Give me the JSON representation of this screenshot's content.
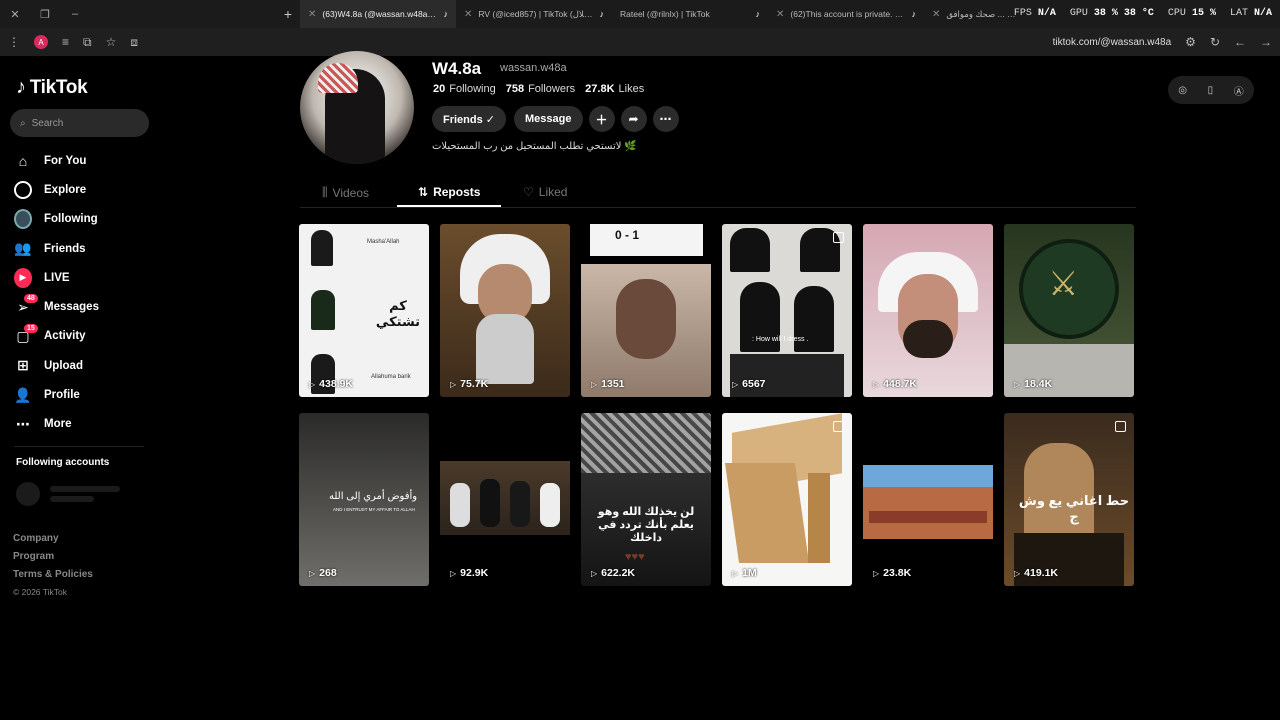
{
  "browser": {
    "tabs": [
      {
        "title": "(63)W4.8a (@wassan.w48a) | Ti",
        "active": true
      },
      {
        "title": "RV (@iced857) | TikTok (طلال)",
        "active": false
      },
      {
        "title": "Rateel (@rilnlx) | TikTok",
        "active": false
      },
      {
        "title": "(62)This account is private. Foll",
        "active": false
      },
      {
        "title": "ردة ... صحك وموافق",
        "active": false
      }
    ],
    "url": "tiktok.com/@wassan.w48a",
    "profile_initial": "A"
  },
  "hud": {
    "fps_label": "FPS",
    "fps_value": "N/A",
    "gpu_label": "GPU",
    "gpu_value": "38 % 38 °C",
    "cpu_label": "CPU",
    "cpu_value": "15 %",
    "lat_label": "LAT",
    "lat_value": "N/A"
  },
  "sidebar": {
    "logo_text": "TikTok",
    "search_placeholder": "Search",
    "nav": [
      {
        "label": "For You",
        "icon": "home-icon"
      },
      {
        "label": "Explore",
        "icon": "compass-icon"
      },
      {
        "label": "Following",
        "icon": "following-avatar-icon"
      },
      {
        "label": "Friends",
        "icon": "friends-icon"
      },
      {
        "label": "LIVE",
        "icon": "live-icon"
      },
      {
        "label": "Messages",
        "icon": "messages-icon",
        "badge": "48"
      },
      {
        "label": "Activity",
        "icon": "activity-icon",
        "badge": "15"
      },
      {
        "label": "Upload",
        "icon": "upload-icon"
      },
      {
        "label": "Profile",
        "icon": "profile-icon"
      },
      {
        "label": "More",
        "icon": "more-icon"
      }
    ],
    "following_accounts_title": "Following accounts",
    "footer": {
      "company": "Company",
      "program": "Program",
      "terms": "Terms & Policies",
      "copyright": "© 2026 TikTok"
    }
  },
  "profile": {
    "display_name": "W4.8a",
    "username": "wassan.w48a",
    "following_count": "20",
    "following_label": "Following",
    "followers_count": "758",
    "followers_label": "Followers",
    "likes_count": "27.8K",
    "likes_label": "Likes",
    "friends_btn": "Friends ✓",
    "message_btn": "Message",
    "bio": "🌿 لاتستحي تطلب المستحيل من رب المستحيلات"
  },
  "tabs": {
    "videos": "Videos",
    "reposts": "Reposts",
    "liked": "Liked"
  },
  "videos": [
    {
      "views": "438.9K"
    },
    {
      "views": "75.7K"
    },
    {
      "views": "1351"
    },
    {
      "views": "6567",
      "multi": true
    },
    {
      "views": "448.7K"
    },
    {
      "views": "18.4K"
    },
    {
      "views": "268"
    },
    {
      "views": "92.9K"
    },
    {
      "views": "622.2K"
    },
    {
      "views": "1M",
      "multi": true
    },
    {
      "views": "23.8K"
    },
    {
      "views": "419.1K",
      "multi": true
    }
  ],
  "thumb_text": {
    "t1_title": "كم تشتكي",
    "t1_top": "Masha'Allah",
    "t1_bottom": "Allahuma barik",
    "t3_score": "0 - 1",
    "t4_caption": ": How will I dress .",
    "t7_caption": "وأفوض أمري إلى الله",
    "t7_sub": "AND I ENTRUST MY AFFAIR TO ALLAH",
    "t9_caption": "لن يخذلك الله وهو يعلم بأنك تردد في داخلك",
    "t12_caption": "حط اغاني يع وش ج"
  }
}
